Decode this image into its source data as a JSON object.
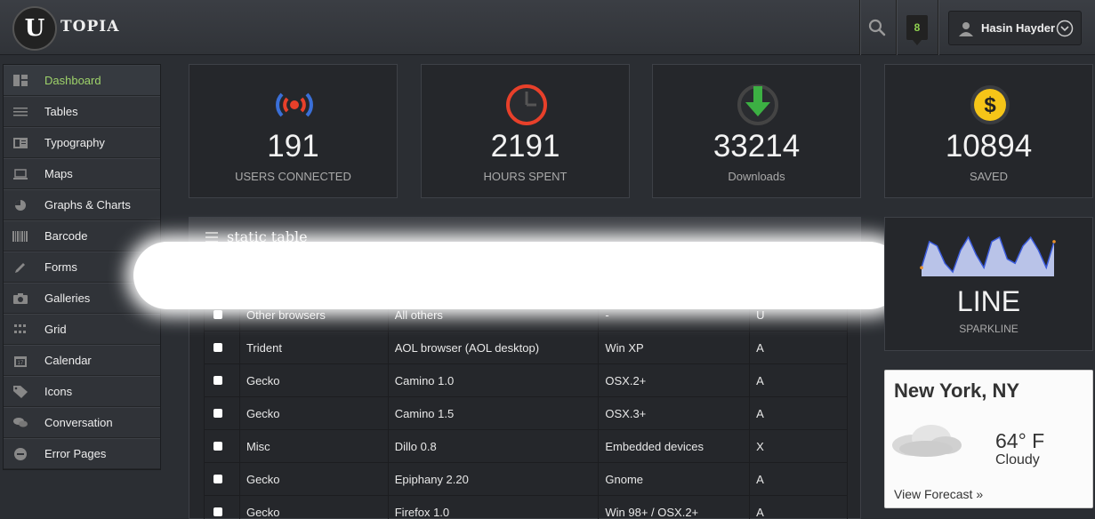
{
  "header": {
    "logo_letter": "U",
    "logo_text": "TOPIA",
    "notification_count": "8",
    "user_name": "Hasin Hayder"
  },
  "sidebar": {
    "items": [
      {
        "label": "Dashboard",
        "icon": "dashboard-icon",
        "active": true
      },
      {
        "label": "Tables",
        "icon": "tables-icon"
      },
      {
        "label": "Typography",
        "icon": "typography-icon"
      },
      {
        "label": "Maps",
        "icon": "maps-icon"
      },
      {
        "label": "Graphs & Charts",
        "icon": "pie-chart-icon"
      },
      {
        "label": "Barcode",
        "icon": "barcode-icon"
      },
      {
        "label": "Forms",
        "icon": "pencil-icon"
      },
      {
        "label": "Galleries",
        "icon": "camera-icon"
      },
      {
        "label": "Grid",
        "icon": "grid-icon"
      },
      {
        "label": "Calendar",
        "icon": "calendar-icon"
      },
      {
        "label": "Icons",
        "icon": "tag-icon"
      },
      {
        "label": "Conversation",
        "icon": "chat-icon"
      },
      {
        "label": "Error Pages",
        "icon": "minus-circle-icon"
      }
    ]
  },
  "stats": [
    {
      "value": "191",
      "label": "USERS CONNECTED",
      "icon": "broadcast-icon",
      "color": "#e8402a"
    },
    {
      "value": "2191",
      "label": "HOURS SPENT",
      "icon": "clock-icon",
      "color": "#e8402a"
    },
    {
      "value": "33214",
      "label": "Downloads",
      "icon": "download-icon",
      "color": "#3cb043"
    },
    {
      "value": "10894",
      "label": "SAVED",
      "icon": "dollar-icon",
      "color": "#f5c518"
    }
  ],
  "table": {
    "title": "static table",
    "rows": [
      [
        "Other browsers",
        "All others",
        "-",
        "U"
      ],
      [
        "Trident",
        "AOL browser (AOL desktop)",
        "Win XP",
        "A"
      ],
      [
        "Gecko",
        "Camino 1.0",
        "OSX.2+",
        "A"
      ],
      [
        "Gecko",
        "Camino 1.5",
        "OSX.3+",
        "A"
      ],
      [
        "Misc",
        "Dillo 0.8",
        "Embedded devices",
        "X"
      ],
      [
        "Gecko",
        "Epiphany 2.20",
        "Gnome",
        "A"
      ],
      [
        "Gecko",
        "Firefox 1.0",
        "Win 98+ / OSX.2+",
        "A"
      ]
    ]
  },
  "sparkline": {
    "big": "LINE",
    "small": "SPARKLINE",
    "color": "#3b5bdb",
    "fill": "#b9c3e8",
    "values": [
      2,
      8,
      7,
      3,
      1,
      6,
      9,
      5,
      2,
      8,
      9,
      4,
      3,
      7,
      9,
      6,
      2,
      8
    ]
  },
  "weather": {
    "city": "New York, NY",
    "temp": "64° F",
    "condition": "Cloudy",
    "link": "View Forecast »"
  }
}
